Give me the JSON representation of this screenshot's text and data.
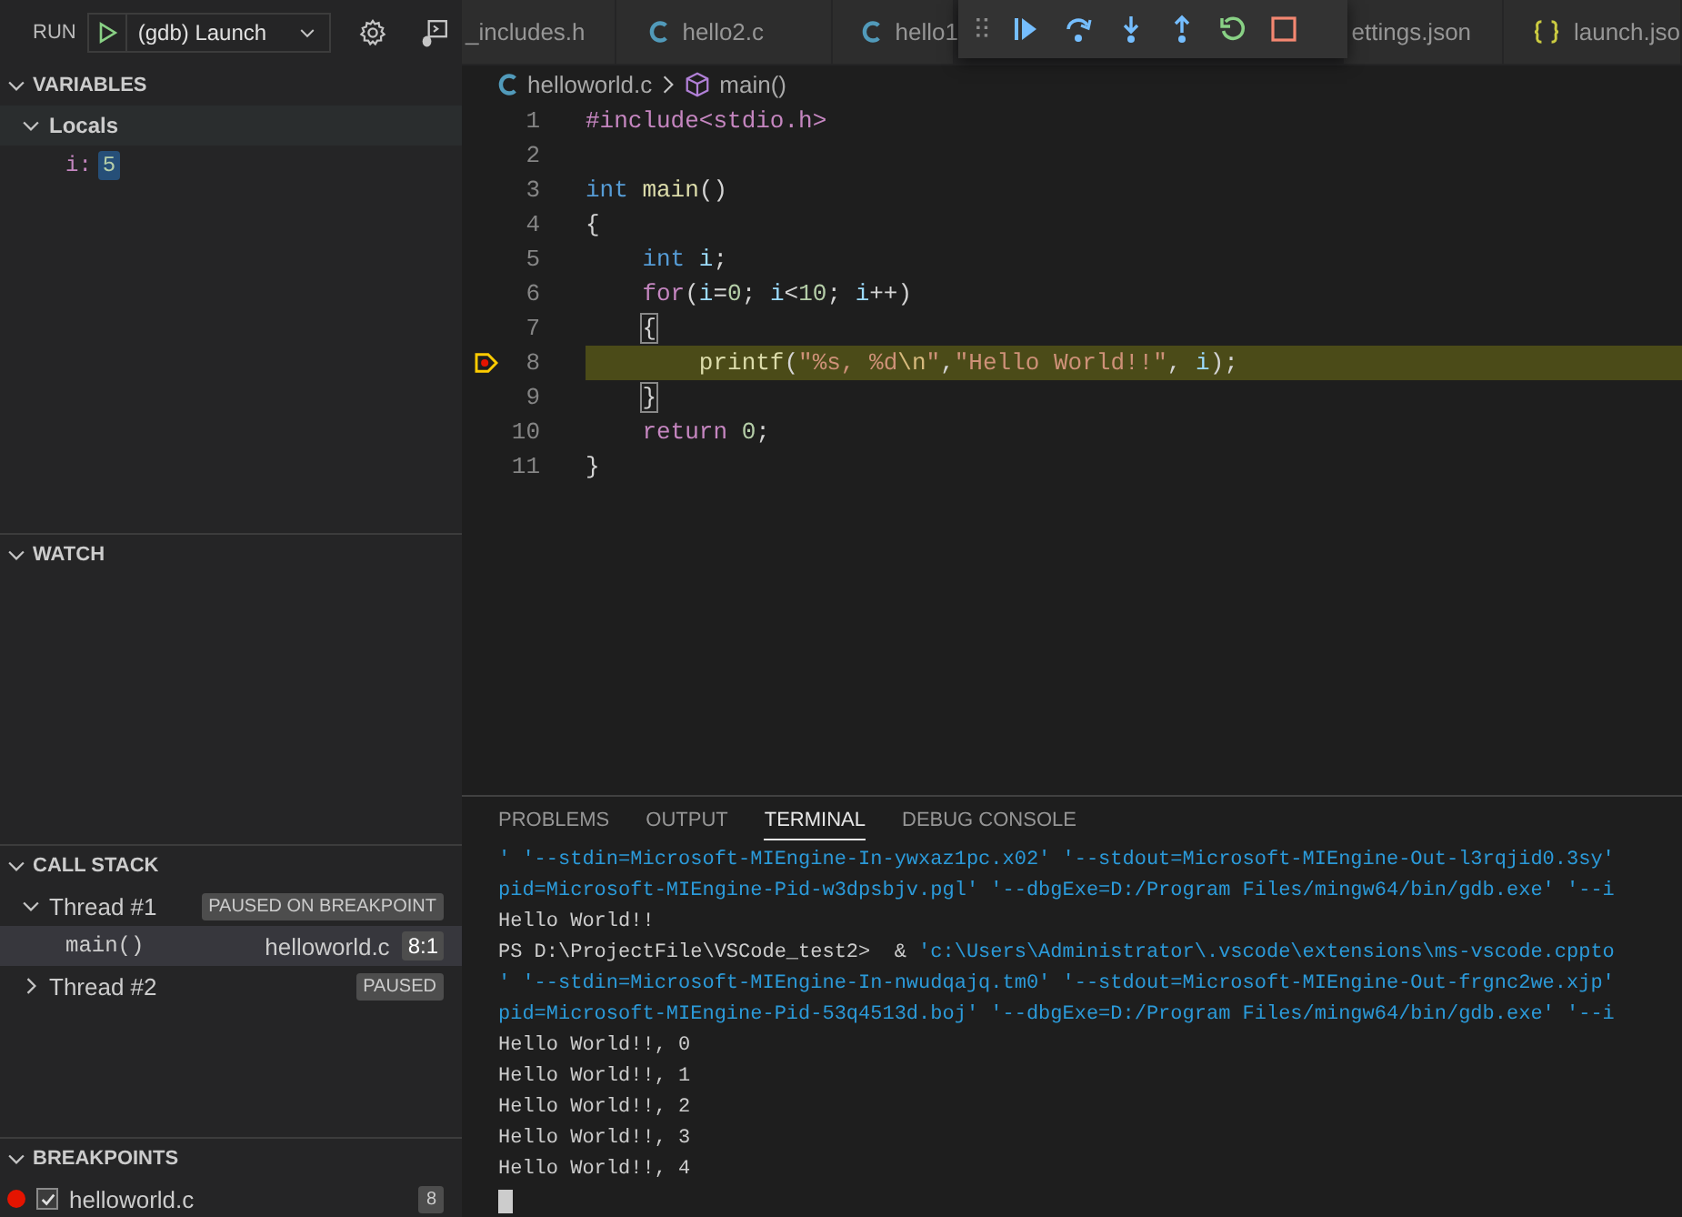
{
  "run_bar": {
    "label": "RUN",
    "configuration": "(gdb) Launch"
  },
  "editor_tabs": [
    {
      "label": "_includes.h",
      "kind": "plain"
    },
    {
      "label": "hello2.c",
      "kind": "c"
    },
    {
      "label": "hello1",
      "kind": "c"
    },
    {
      "label": "ettings.json",
      "kind": "plain"
    },
    {
      "label": "launch.jso",
      "kind": "json"
    }
  ],
  "variables": {
    "title": "VARIABLES",
    "expanded": true,
    "scopes": [
      {
        "name": "Locals",
        "expanded": true,
        "children": [
          {
            "name": "i:",
            "value": "5"
          }
        ]
      }
    ]
  },
  "watch": {
    "title": "WATCH",
    "expanded": true
  },
  "call_stack": {
    "title": "CALL STACK",
    "expanded": true,
    "threads": [
      {
        "name": "Thread #1",
        "status": "PAUSED ON BREAKPOINT",
        "expanded": true,
        "children": [
          {
            "function": "main()",
            "file": "helloworld.c",
            "position": "8:1",
            "selected": true
          }
        ]
      },
      {
        "name": "Thread #2",
        "status": "PAUSED",
        "expanded": false
      }
    ]
  },
  "breakpoints": {
    "title": "BREAKPOINTS",
    "expanded": true,
    "items": [
      {
        "file": "helloworld.c",
        "line": "8",
        "enabled": true
      }
    ]
  },
  "editor": {
    "breadcrumb": {
      "file": "helloworld.c",
      "symbol": "main()"
    },
    "lines": [
      {
        "number": "1",
        "current": false,
        "tokens": [
          {
            "kind": "preproc",
            "text": "#include<stdio.h>"
          }
        ]
      },
      {
        "number": "2",
        "current": false
      },
      {
        "number": "3",
        "current": false,
        "tokens": [
          {
            "kind": "keyword",
            "text": "int"
          },
          {
            "kind": "function",
            "text": " main"
          },
          {
            "kind": "plain",
            "text": "()"
          }
        ]
      },
      {
        "number": "4",
        "current": false,
        "tokens": [
          {
            "kind": "plain",
            "text": "{"
          }
        ]
      },
      {
        "number": "5",
        "current": false,
        "tokens": [
          {
            "kind": "keyword",
            "text": "    int"
          },
          {
            "kind": "variable",
            "text": " i"
          },
          {
            "kind": "plain",
            "text": ";"
          }
        ]
      },
      {
        "number": "6",
        "current": false,
        "tokens": [
          {
            "kind": "control",
            "text": "    for"
          },
          {
            "kind": "plain",
            "text": "("
          },
          {
            "kind": "variable",
            "text": "i"
          },
          {
            "kind": "plain",
            "text": "="
          },
          {
            "kind": "number",
            "text": "0"
          },
          {
            "kind": "plain",
            "text": "; "
          },
          {
            "kind": "variable",
            "text": "i"
          },
          {
            "kind": "plain",
            "text": "<"
          },
          {
            "kind": "number",
            "text": "10"
          },
          {
            "kind": "plain",
            "text": "; "
          },
          {
            "kind": "variable",
            "text": "i"
          },
          {
            "kind": "plain",
            "text": "++)"
          }
        ]
      },
      {
        "number": "7",
        "current": false,
        "tokens": [
          {
            "kind": "bracket",
            "indented": true,
            "text": "{"
          }
        ]
      },
      {
        "number": "8",
        "current": true,
        "tokens": [
          {
            "kind": "function",
            "text": "        printf"
          },
          {
            "kind": "plain",
            "text": "("
          },
          {
            "kind": "string",
            "text": "\"%s, %d"
          },
          {
            "kind": "escape",
            "text": "\\n"
          },
          {
            "kind": "string",
            "text": "\""
          },
          {
            "kind": "plain",
            "text": ","
          },
          {
            "kind": "string",
            "text": "\"Hello World!!\""
          },
          {
            "kind": "plain",
            "text": ", "
          },
          {
            "kind": "variable",
            "text": "i"
          },
          {
            "kind": "plain",
            "text": ");"
          }
        ]
      },
      {
        "number": "9",
        "current": false,
        "tokens": [
          {
            "kind": "bracket",
            "indented": true,
            "text": "}"
          }
        ]
      },
      {
        "number": "10",
        "current": false,
        "tokens": [
          {
            "kind": "control",
            "text": "    return"
          },
          {
            "kind": "number",
            "text": " 0"
          },
          {
            "kind": "plain",
            "text": ";"
          }
        ]
      },
      {
        "number": "11",
        "current": false,
        "tokens": [
          {
            "kind": "plain",
            "text": "}"
          }
        ]
      }
    ]
  },
  "panel": {
    "tabs": [
      {
        "label": "PROBLEMS",
        "selected": false
      },
      {
        "label": "OUTPUT",
        "selected": false
      },
      {
        "label": "TERMINAL",
        "selected": true
      },
      {
        "label": "DEBUG CONSOLE",
        "selected": false
      }
    ],
    "terminal_lines": [
      {
        "segments": [
          {
            "kind": "info",
            "text": "' '--stdin=Microsoft-MIEngine-In-ywxaz1pc.x02' '--stdout=Microsoft-MIEngine-Out-l3rqjid0.3sy'"
          }
        ]
      },
      {
        "segments": [
          {
            "kind": "info",
            "text": "pid=Microsoft-MIEngine-Pid-w3dpsbjv.pgl' '--dbgExe=D:/Program Files/mingw64/bin/gdb.exe' '--i"
          }
        ]
      },
      {
        "segments": [
          {
            "kind": "plain",
            "text": "Hello World!!"
          }
        ]
      },
      {
        "segments": [
          {
            "kind": "plain",
            "text": "PS D:\\ProjectFile\\VSCode_test2>  & "
          },
          {
            "kind": "info",
            "text": "'c:\\Users\\Administrator\\.vscode\\extensions\\ms-vscode.cppto"
          }
        ]
      },
      {
        "segments": [
          {
            "kind": "info",
            "text": "' '--stdin=Microsoft-MIEngine-In-nwudqajq.tm0' '--stdout=Microsoft-MIEngine-Out-frgnc2we.xjp'"
          }
        ]
      },
      {
        "segments": [
          {
            "kind": "info",
            "text": "pid=Microsoft-MIEngine-Pid-53q4513d.boj' '--dbgExe=D:/Program Files/mingw64/bin/gdb.exe' '--i"
          }
        ]
      },
      {
        "segments": [
          {
            "kind": "plain",
            "text": "Hello World!!, 0"
          }
        ]
      },
      {
        "segments": [
          {
            "kind": "plain",
            "text": "Hello World!!, 1"
          }
        ]
      },
      {
        "segments": [
          {
            "kind": "plain",
            "text": "Hello World!!, 2"
          }
        ]
      },
      {
        "segments": [
          {
            "kind": "plain",
            "text": "Hello World!!, 3"
          }
        ]
      },
      {
        "segments": [
          {
            "kind": "plain",
            "text": "Hello World!!, 4"
          }
        ]
      }
    ]
  }
}
